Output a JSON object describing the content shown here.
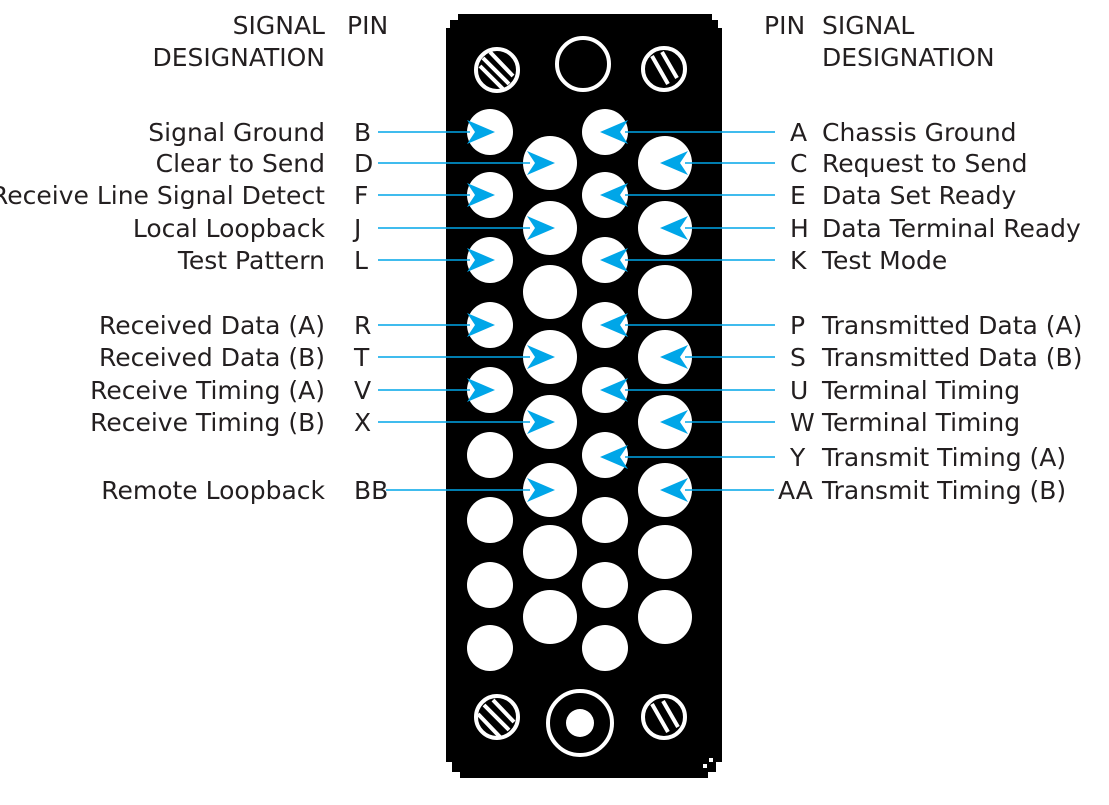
{
  "headers": {
    "left_signal": "SIGNAL",
    "left_designation": "DESIGNATION",
    "left_pin": "PIN",
    "right_pin": "PIN",
    "right_signal": "SIGNAL",
    "right_designation": "DESIGNATION"
  },
  "left_signals": [
    {
      "pin": "B",
      "signal": "Signal Ground"
    },
    {
      "pin": "D",
      "signal": "Clear to Send"
    },
    {
      "pin": "F",
      "signal": "Receive Line Signal Detect"
    },
    {
      "pin": "J",
      "signal": "Local Loopback"
    },
    {
      "pin": "L",
      "signal": "Test Pattern"
    },
    {
      "pin": "R",
      "signal": "Received Data (A)"
    },
    {
      "pin": "T",
      "signal": "Received Data (B)"
    },
    {
      "pin": "V",
      "signal": "Receive Timing (A)"
    },
    {
      "pin": "X",
      "signal": "Receive Timing (B)"
    },
    {
      "pin": "BB",
      "signal": "Remote Loopback"
    }
  ],
  "right_signals": [
    {
      "pin": "A",
      "signal": "Chassis Ground"
    },
    {
      "pin": "C",
      "signal": "Request to Send"
    },
    {
      "pin": "E",
      "signal": "Data Set Ready"
    },
    {
      "pin": "H",
      "signal": "Data Terminal Ready"
    },
    {
      "pin": "K",
      "signal": "Test Mode"
    },
    {
      "pin": "P",
      "signal": "Transmitted Data (A)"
    },
    {
      "pin": "S",
      "signal": "Transmitted Data (B)"
    },
    {
      "pin": "U",
      "signal": "Terminal Timing"
    },
    {
      "pin": "W",
      "signal": "Terminal Timing"
    },
    {
      "pin": "Y",
      "signal": "Transmit Timing (A)"
    },
    {
      "pin": "AA",
      "signal": "Transmit Timing (B)"
    }
  ],
  "colors": {
    "leader": "#00a6e8",
    "connector_body": "#000000",
    "pin": "#ffffff",
    "text": "#231f20"
  }
}
